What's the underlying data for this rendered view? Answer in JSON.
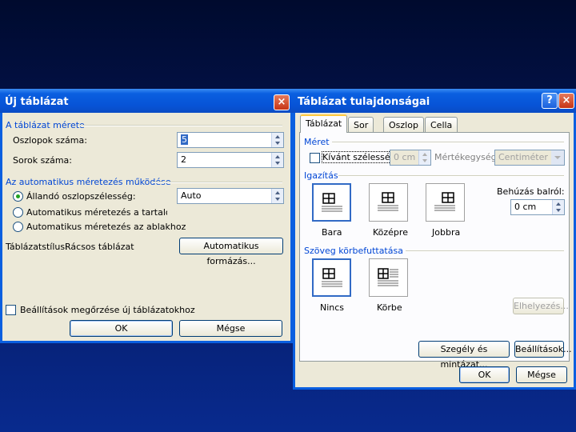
{
  "dialog1": {
    "title": "Új táblázat",
    "group_size": "A táblázat mérete",
    "columns_label": "Oszlopok száma:",
    "columns_value": "5",
    "rows_label": "Sorok száma:",
    "rows_value": "2",
    "group_autofit": "Az automatikus méretezés működése",
    "radio_fixed": "Állandó oszlopszélesség:",
    "fixed_value": "Auto",
    "radio_content": "Automatikus méretezés a tartalomhoz",
    "radio_window": "Automatikus méretezés az ablakhoz",
    "style_label": "Táblázatstílus:",
    "style_value": "Rácsos táblázat",
    "autoformat_button": "Automatikus formázás...",
    "remember_checkbox": "Beállítások megőrzése új táblázatokhoz",
    "ok_button": "OK",
    "cancel_button": "Mégse"
  },
  "dialog2": {
    "title": "Táblázat tulajdonságai",
    "tabs": [
      "Táblázat",
      "Sor",
      "Oszlop",
      "Cella"
    ],
    "group_size": "Méret",
    "preferred_width_label": "Kívánt szélesség:",
    "preferred_width_value": "0 cm",
    "unit_label": "Mértékegység:",
    "unit_value": "Centiméter",
    "group_alignment": "Igazítás",
    "align_left": "Bara",
    "align_center": "Középre",
    "align_right": "Jobbra",
    "indent_label": "Behúzás balról:",
    "indent_value": "0 cm",
    "group_wrap": "Szöveg körbefuttatása",
    "wrap_none": "Nincs",
    "wrap_around": "Körbe",
    "positioning_button": "Elhelyezés...",
    "borders_button": "Szegély és mintázat...",
    "options_button": "Beállítások...",
    "ok_button": "OK",
    "cancel_button": "Mégse"
  },
  "icons": {
    "close": "×",
    "help": "?",
    "colors": {
      "accent": "#0a5fe0",
      "group_title": "#0046d5",
      "panel": "#ece9d8"
    }
  }
}
